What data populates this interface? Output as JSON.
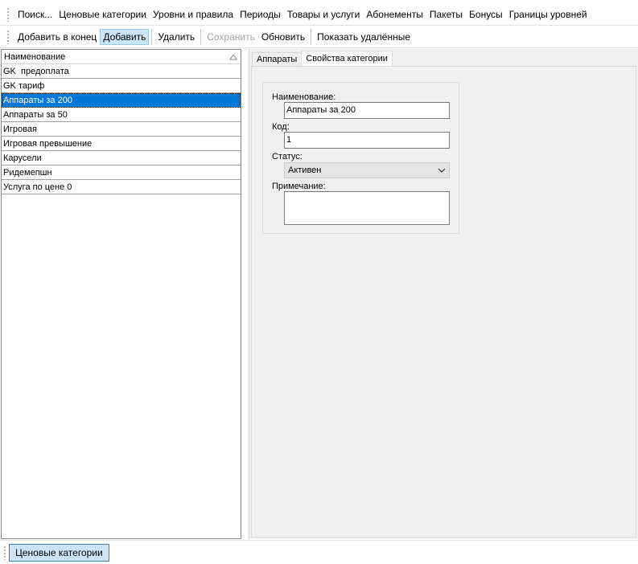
{
  "menu": {
    "items": [
      "Поиск...",
      "Ценовые категории",
      "Уровни и правила",
      "Периоды",
      "Товары и услуги",
      "Абонементы",
      "Пакеты",
      "Бонусы",
      "Границы уровней"
    ]
  },
  "actions": {
    "add_end": "Добавить в конец",
    "add": "Добавить",
    "delete": "Удалить",
    "save": "Сохранить",
    "refresh": "Обновить",
    "show_deleted": "Показать удалённые"
  },
  "list": {
    "header": "Наименование",
    "sort_icon": "sort-ascending-icon",
    "rows": [
      "GK  предоплата",
      "GK тариф",
      "Аппараты за 200",
      "Аппараты за 50",
      "Игровая",
      "Игровая превышение",
      "Карусели",
      "Ридемепшн",
      "Услуга по цене 0"
    ],
    "selected_index": 2
  },
  "tabs": {
    "devices": "Аппараты",
    "properties": "Свойства категории"
  },
  "form": {
    "name_label": "Наименование:",
    "name_value": "Аппараты за 200",
    "code_label": "Код:",
    "code_value": "1",
    "status_label": "Статус:",
    "status_value": "Активен",
    "note_label": "Примечание:",
    "note_value": ""
  },
  "bottom": {
    "button": "Ценовые категории"
  },
  "colors": {
    "selection": "#0078d7",
    "active_button": "#cce4f7",
    "panel_bg": "#f0f0f0"
  }
}
